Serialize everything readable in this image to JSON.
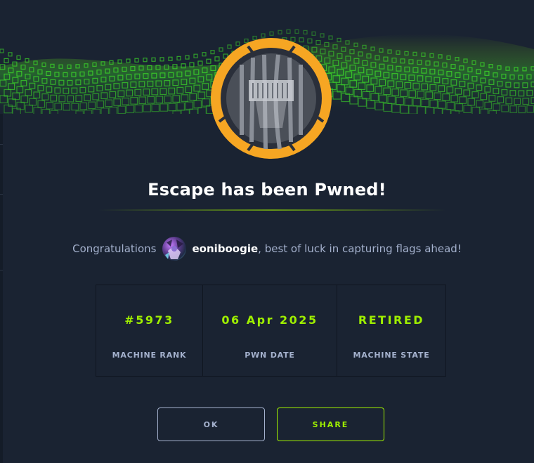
{
  "modal": {
    "title": "Escape has been Pwned!",
    "congrats_prefix": "Congratulations",
    "username": "eoniboogie",
    "congrats_suffix": ", best of luck in capturing flags ahead!"
  },
  "stats": [
    {
      "value": "#5973",
      "label": "MACHINE RANK"
    },
    {
      "value": "06 Apr 2025",
      "label": "PWN DATE"
    },
    {
      "value": "RETIRED",
      "label": "MACHINE STATE"
    }
  ],
  "buttons": {
    "ok": "OK",
    "share": "SHARE"
  },
  "colors": {
    "background": "#1a2332",
    "accent_green": "#9fef00",
    "badge_ring": "#f6a623",
    "muted_text": "#a4b1cd"
  },
  "icons": {
    "badge": "machine-badge-icon",
    "avatar": "user-avatar"
  }
}
